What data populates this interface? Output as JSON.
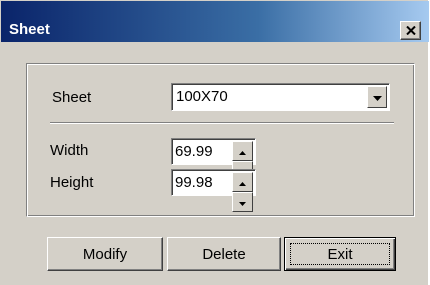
{
  "window": {
    "title": "Sheet",
    "close_icon": "close-icon"
  },
  "form": {
    "sheet_label": "Sheet",
    "sheet_value": "100X70",
    "width_label": "Width",
    "width_value": "69.99",
    "height_label": "Height",
    "height_value": "99.98"
  },
  "buttons": {
    "modify": "Modify",
    "delete": "Delete",
    "exit": "Exit"
  },
  "colors": {
    "titlebar_start": "#0a246a",
    "titlebar_end": "#a6caf0",
    "face": "#d4d0c8"
  }
}
